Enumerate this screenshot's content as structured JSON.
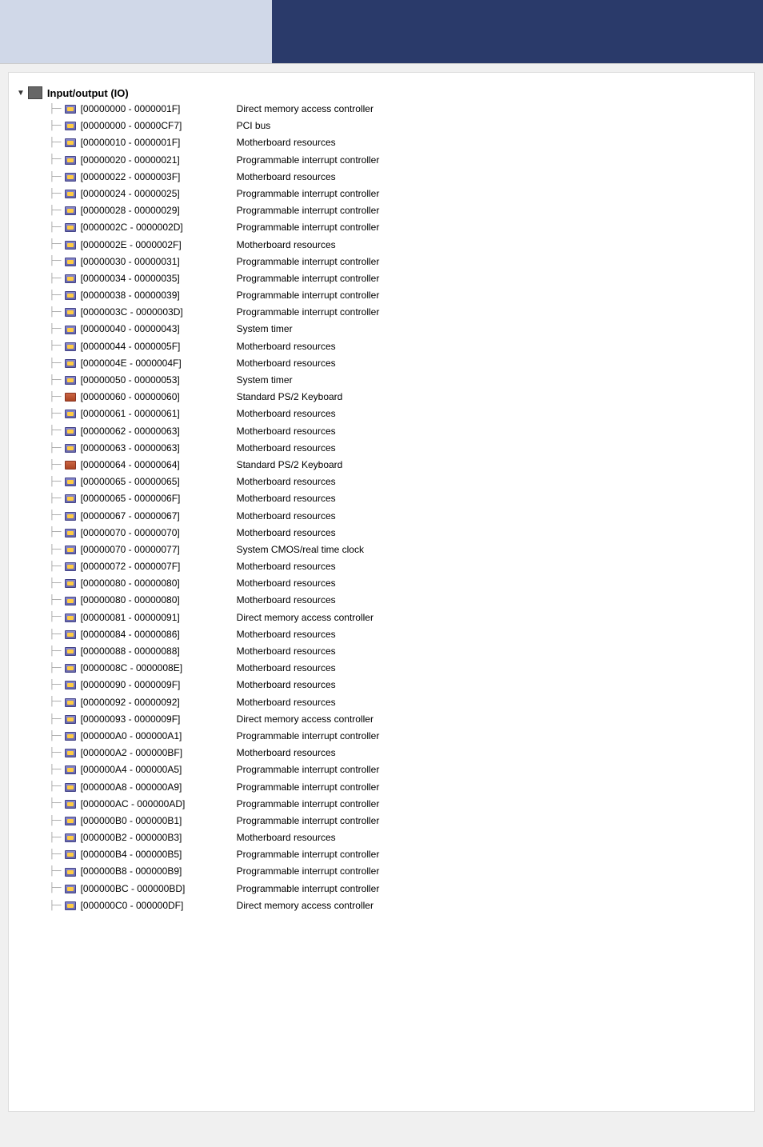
{
  "topbar": {
    "left_label": "",
    "right_label": ""
  },
  "tree": {
    "root_label": "Input/output (IO)",
    "items": [
      {
        "address": "[00000000 - 0000001F]",
        "description": "Direct memory access controller",
        "icon": "chip"
      },
      {
        "address": "[00000000 - 00000CF7]",
        "description": "PCI bus",
        "icon": "chip"
      },
      {
        "address": "[00000010 - 0000001F]",
        "description": "Motherboard resources",
        "icon": "chip"
      },
      {
        "address": "[00000020 - 00000021]",
        "description": "Programmable interrupt controller",
        "icon": "chip"
      },
      {
        "address": "[00000022 - 0000003F]",
        "description": "Motherboard resources",
        "icon": "chip"
      },
      {
        "address": "[00000024 - 00000025]",
        "description": "Programmable interrupt controller",
        "icon": "chip"
      },
      {
        "address": "[00000028 - 00000029]",
        "description": "Programmable interrupt controller",
        "icon": "chip"
      },
      {
        "address": "[0000002C - 0000002D]",
        "description": "Programmable interrupt controller",
        "icon": "chip"
      },
      {
        "address": "[0000002E - 0000002F]",
        "description": "Motherboard resources",
        "icon": "chip"
      },
      {
        "address": "[00000030 - 00000031]",
        "description": "Programmable interrupt controller",
        "icon": "chip"
      },
      {
        "address": "[00000034 - 00000035]",
        "description": "Programmable interrupt controller",
        "icon": "chip"
      },
      {
        "address": "[00000038 - 00000039]",
        "description": "Programmable interrupt controller",
        "icon": "chip"
      },
      {
        "address": "[0000003C - 0000003D]",
        "description": "Programmable interrupt controller",
        "icon": "chip"
      },
      {
        "address": "[00000040 - 00000043]",
        "description": "System timer",
        "icon": "chip"
      },
      {
        "address": "[00000044 - 0000005F]",
        "description": "Motherboard resources",
        "icon": "chip"
      },
      {
        "address": "[0000004E - 0000004F]",
        "description": "Motherboard resources",
        "icon": "chip"
      },
      {
        "address": "[00000050 - 00000053]",
        "description": "System timer",
        "icon": "chip"
      },
      {
        "address": "[00000060 - 00000060]",
        "description": "Standard PS/2 Keyboard",
        "icon": "kb"
      },
      {
        "address": "[00000061 - 00000061]",
        "description": "Motherboard resources",
        "icon": "chip"
      },
      {
        "address": "[00000062 - 00000063]",
        "description": "Motherboard resources",
        "icon": "chip"
      },
      {
        "address": "[00000063 - 00000063]",
        "description": "Motherboard resources",
        "icon": "chip"
      },
      {
        "address": "[00000064 - 00000064]",
        "description": "Standard PS/2 Keyboard",
        "icon": "kb"
      },
      {
        "address": "[00000065 - 00000065]",
        "description": "Motherboard resources",
        "icon": "chip"
      },
      {
        "address": "[00000065 - 0000006F]",
        "description": "Motherboard resources",
        "icon": "chip"
      },
      {
        "address": "[00000067 - 00000067]",
        "description": "Motherboard resources",
        "icon": "chip"
      },
      {
        "address": "[00000070 - 00000070]",
        "description": "Motherboard resources",
        "icon": "chip"
      },
      {
        "address": "[00000070 - 00000077]",
        "description": "System CMOS/real time clock",
        "icon": "chip"
      },
      {
        "address": "[00000072 - 0000007F]",
        "description": "Motherboard resources",
        "icon": "chip"
      },
      {
        "address": "[00000080 - 00000080]",
        "description": "Motherboard resources",
        "icon": "chip"
      },
      {
        "address": "[00000080 - 00000080]",
        "description": "Motherboard resources",
        "icon": "chip"
      },
      {
        "address": "[00000081 - 00000091]",
        "description": "Direct memory access controller",
        "icon": "chip"
      },
      {
        "address": "[00000084 - 00000086]",
        "description": "Motherboard resources",
        "icon": "chip"
      },
      {
        "address": "[00000088 - 00000088]",
        "description": "Motherboard resources",
        "icon": "chip"
      },
      {
        "address": "[0000008C - 0000008E]",
        "description": "Motherboard resources",
        "icon": "chip"
      },
      {
        "address": "[00000090 - 0000009F]",
        "description": "Motherboard resources",
        "icon": "chip"
      },
      {
        "address": "[00000092 - 00000092]",
        "description": "Motherboard resources",
        "icon": "chip"
      },
      {
        "address": "[00000093 - 0000009F]",
        "description": "Direct memory access controller",
        "icon": "chip"
      },
      {
        "address": "[000000A0 - 000000A1]",
        "description": "Programmable interrupt controller",
        "icon": "chip"
      },
      {
        "address": "[000000A2 - 000000BF]",
        "description": "Motherboard resources",
        "icon": "chip"
      },
      {
        "address": "[000000A4 - 000000A5]",
        "description": "Programmable interrupt controller",
        "icon": "chip"
      },
      {
        "address": "[000000A8 - 000000A9]",
        "description": "Programmable interrupt controller",
        "icon": "chip"
      },
      {
        "address": "[000000AC - 000000AD]",
        "description": "Programmable interrupt controller",
        "icon": "chip"
      },
      {
        "address": "[000000B0 - 000000B1]",
        "description": "Programmable interrupt controller",
        "icon": "chip"
      },
      {
        "address": "[000000B2 - 000000B3]",
        "description": "Motherboard resources",
        "icon": "chip"
      },
      {
        "address": "[000000B4 - 000000B5]",
        "description": "Programmable interrupt controller",
        "icon": "chip"
      },
      {
        "address": "[000000B8 - 000000B9]",
        "description": "Programmable interrupt controller",
        "icon": "chip"
      },
      {
        "address": "[000000BC - 000000BD]",
        "description": "Programmable interrupt controller",
        "icon": "chip"
      },
      {
        "address": "[000000C0 - 000000DF]",
        "description": "Direct memory access controller",
        "icon": "chip"
      }
    ]
  }
}
